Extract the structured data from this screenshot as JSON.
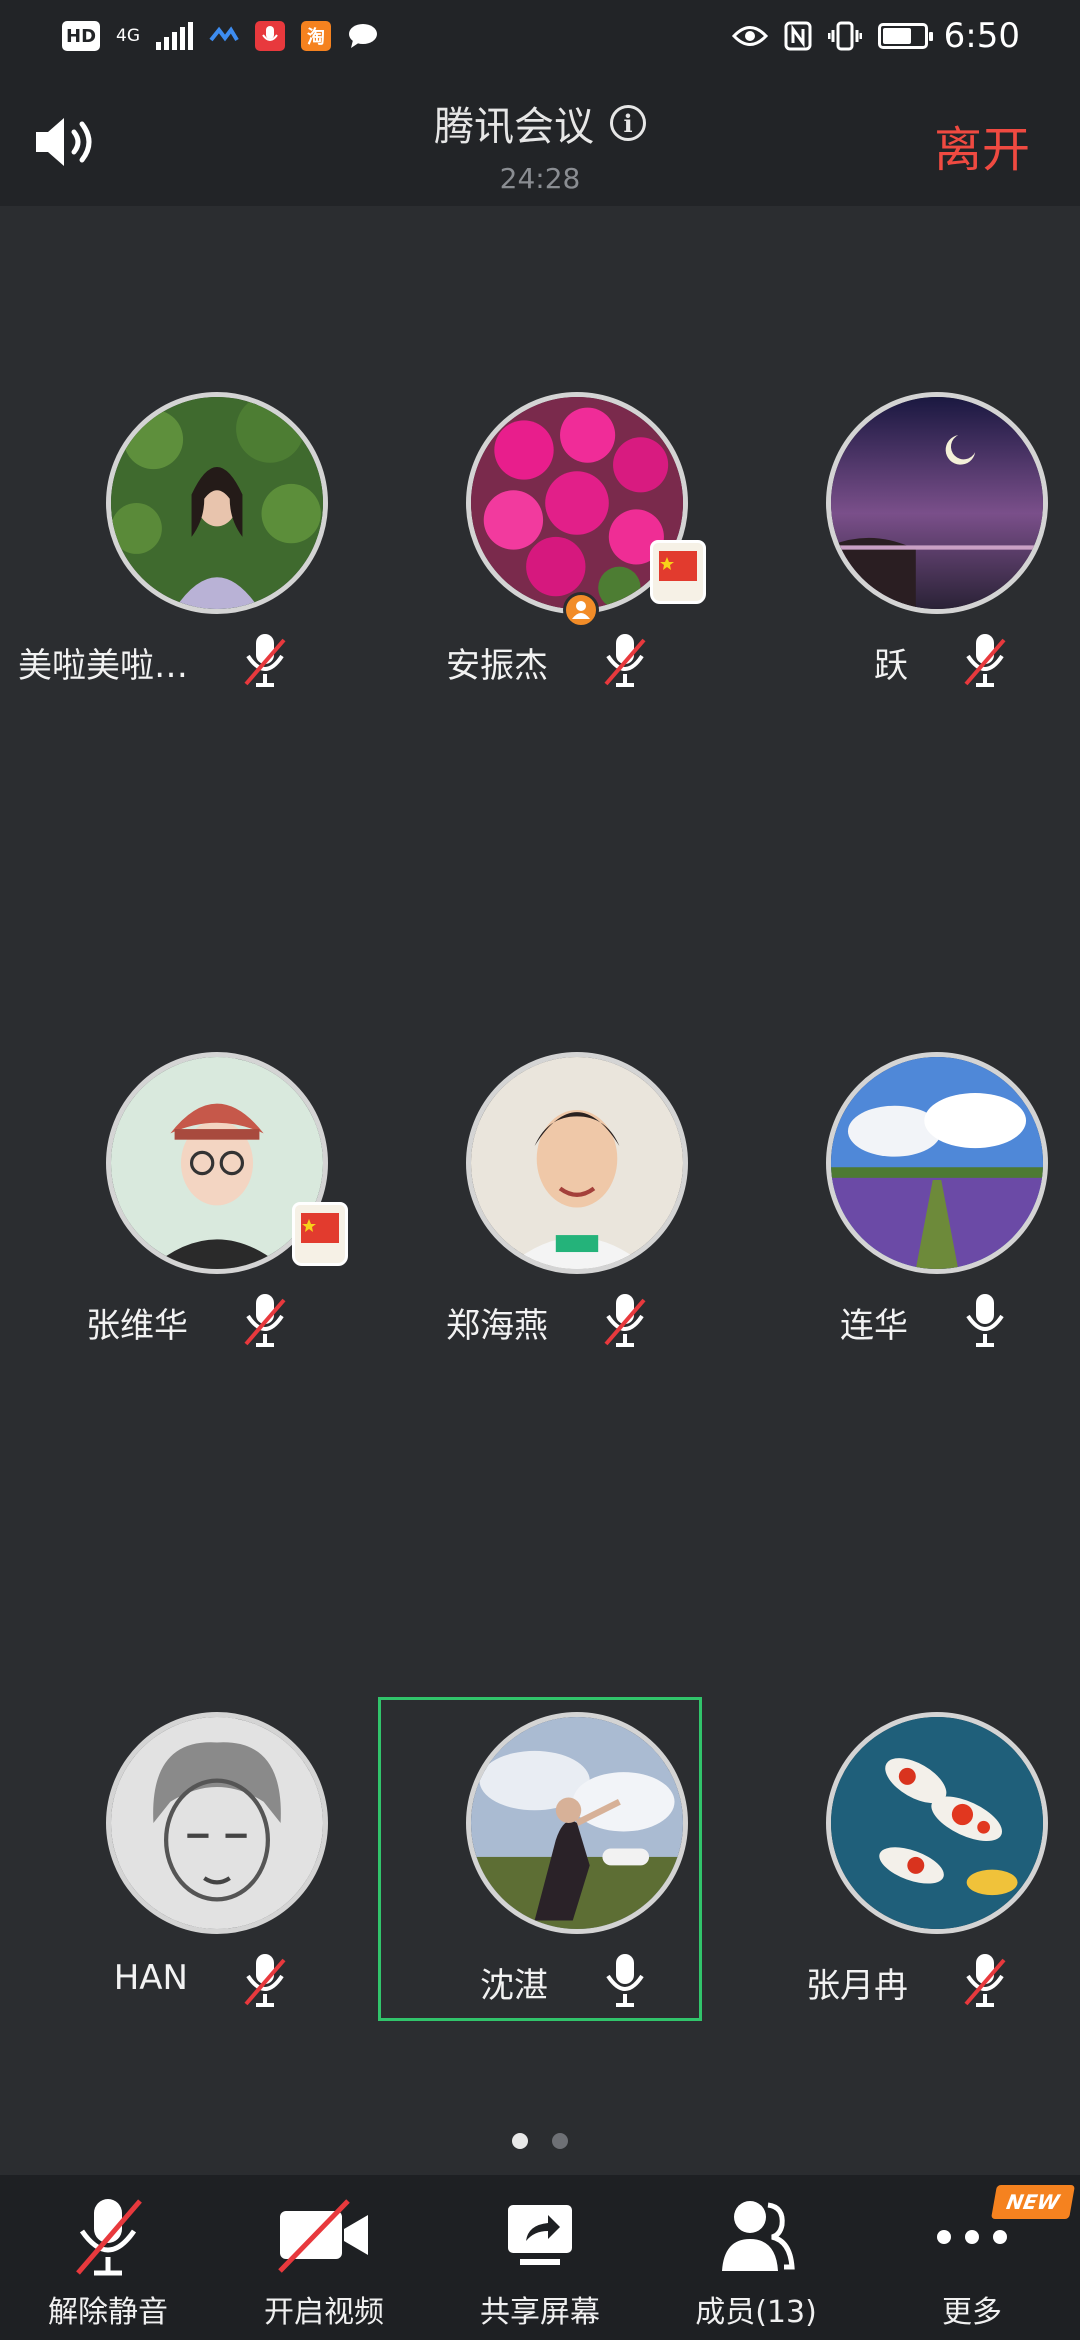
{
  "status_bar": {
    "hd_label": "HD",
    "network_label": "4G",
    "taobao_label": "淘",
    "time": "6:50",
    "battery_percent": 70,
    "icons": [
      "hd-icon",
      "signal-icon",
      "app-icon",
      "mic-app-icon",
      "taobao-app-icon",
      "chat-icon",
      "eye-icon",
      "nfc-icon",
      "vibrate-icon",
      "battery-icon"
    ]
  },
  "header": {
    "title": "腾讯会议",
    "info_glyph": "i",
    "elapsed": "24:28",
    "leave_label": "离开",
    "leave_color": "#f04a41"
  },
  "participants": [
    {
      "name": "美啦美啦…",
      "muted": true
    },
    {
      "name": "安振杰",
      "muted": true,
      "host": true
    },
    {
      "name": "跃",
      "muted": true
    },
    {
      "name": "张维华",
      "muted": true
    },
    {
      "name": "郑海燕",
      "muted": true
    },
    {
      "name": "连华",
      "muted": false
    },
    {
      "name": "HAN",
      "muted": true
    },
    {
      "name": "沈湛",
      "muted": false,
      "speaking": true
    },
    {
      "name": "张月冉",
      "muted": true
    }
  ],
  "pager": {
    "pages": 2,
    "current": 1
  },
  "toolbar": {
    "unmute_label": "解除静音",
    "video_label": "开启视频",
    "share_label": "共享屏幕",
    "members_label": "成员(13)",
    "more_label": "更多",
    "new_badge": "NEW"
  },
  "colors": {
    "background": "#2b2d30",
    "header_bg": "#222427",
    "toolbar_bg": "#1e2023",
    "speaking_border": "#31c46b",
    "mute_slash": "#e8393d",
    "badge": "#f5821f"
  }
}
